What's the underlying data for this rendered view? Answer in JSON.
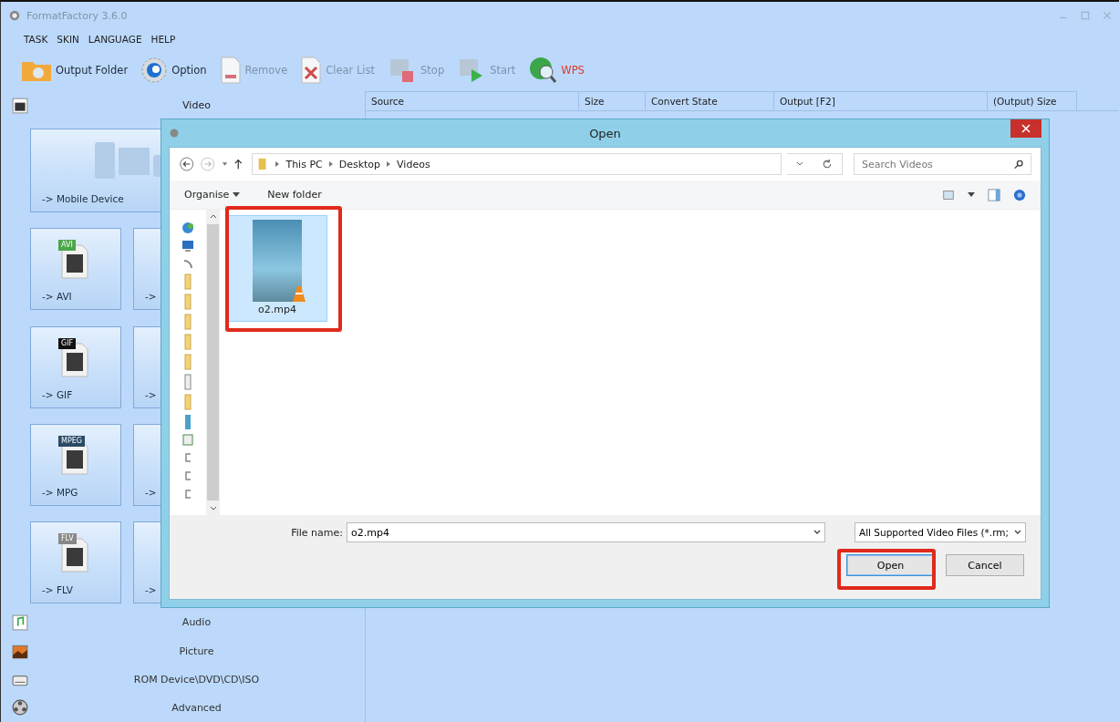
{
  "window": {
    "title": "FormatFactory 3.6.0"
  },
  "menu": [
    "TASK",
    "SKIN",
    "LANGUAGE",
    "HELP"
  ],
  "toolbar": [
    {
      "label": "Output Folder",
      "kind": "folder",
      "disabled": false
    },
    {
      "label": "Option",
      "kind": "gear",
      "disabled": false
    },
    {
      "label": "Remove",
      "kind": "remove",
      "disabled": true
    },
    {
      "label": "Clear List",
      "kind": "clear",
      "disabled": true
    },
    {
      "label": "Stop",
      "kind": "stop",
      "disabled": true
    },
    {
      "label": "Start",
      "kind": "start",
      "disabled": true
    },
    {
      "label": "WPS",
      "kind": "wps",
      "disabled": false
    }
  ],
  "categories": [
    {
      "label": "Video",
      "kind": "video",
      "expanded": true
    },
    {
      "label": "Audio",
      "kind": "audio",
      "expanded": false
    },
    {
      "label": "Picture",
      "kind": "picture",
      "expanded": false
    },
    {
      "label": "ROM Device\\DVD\\CD\\ISO",
      "kind": "disc",
      "expanded": false
    },
    {
      "label": "Advanced",
      "kind": "advanced",
      "expanded": false
    }
  ],
  "video_tiles": [
    {
      "label": "-> Mobile Device",
      "kind": "wide"
    },
    {
      "label": "-> AVI",
      "kind": "format",
      "badge": "AVI"
    },
    {
      "label": "->",
      "kind": "format"
    },
    {
      "label": "-> GIF",
      "kind": "format",
      "badge": "GIF"
    },
    {
      "label": "->",
      "kind": "format"
    },
    {
      "label": "-> MPG",
      "kind": "format",
      "badge": "MPEG"
    },
    {
      "label": "->",
      "kind": "format"
    },
    {
      "label": "-> FLV",
      "kind": "format",
      "badge": "FLV"
    },
    {
      "label": "->",
      "kind": "format"
    }
  ],
  "table": {
    "columns": [
      "Source",
      "Size",
      "Convert State",
      "Output [F2]",
      "(Output) Size"
    ]
  },
  "dialog": {
    "title": "Open",
    "breadcrumb": [
      "This PC",
      "Desktop",
      "Videos"
    ],
    "search": {
      "placeholder": "Search Videos"
    },
    "commands": [
      {
        "label": "Organise",
        "dropdown": true
      },
      {
        "label": "New folder",
        "dropdown": false
      }
    ],
    "files": [
      {
        "name": "o2.mp4",
        "selected": true
      }
    ],
    "file_name": {
      "label": "File name:",
      "value": "o2.mp4"
    },
    "filter": "All Supported Video Files (*.rm;",
    "buttons": [
      {
        "label": "Open",
        "default": true
      },
      {
        "label": "Cancel",
        "default": false
      }
    ]
  }
}
